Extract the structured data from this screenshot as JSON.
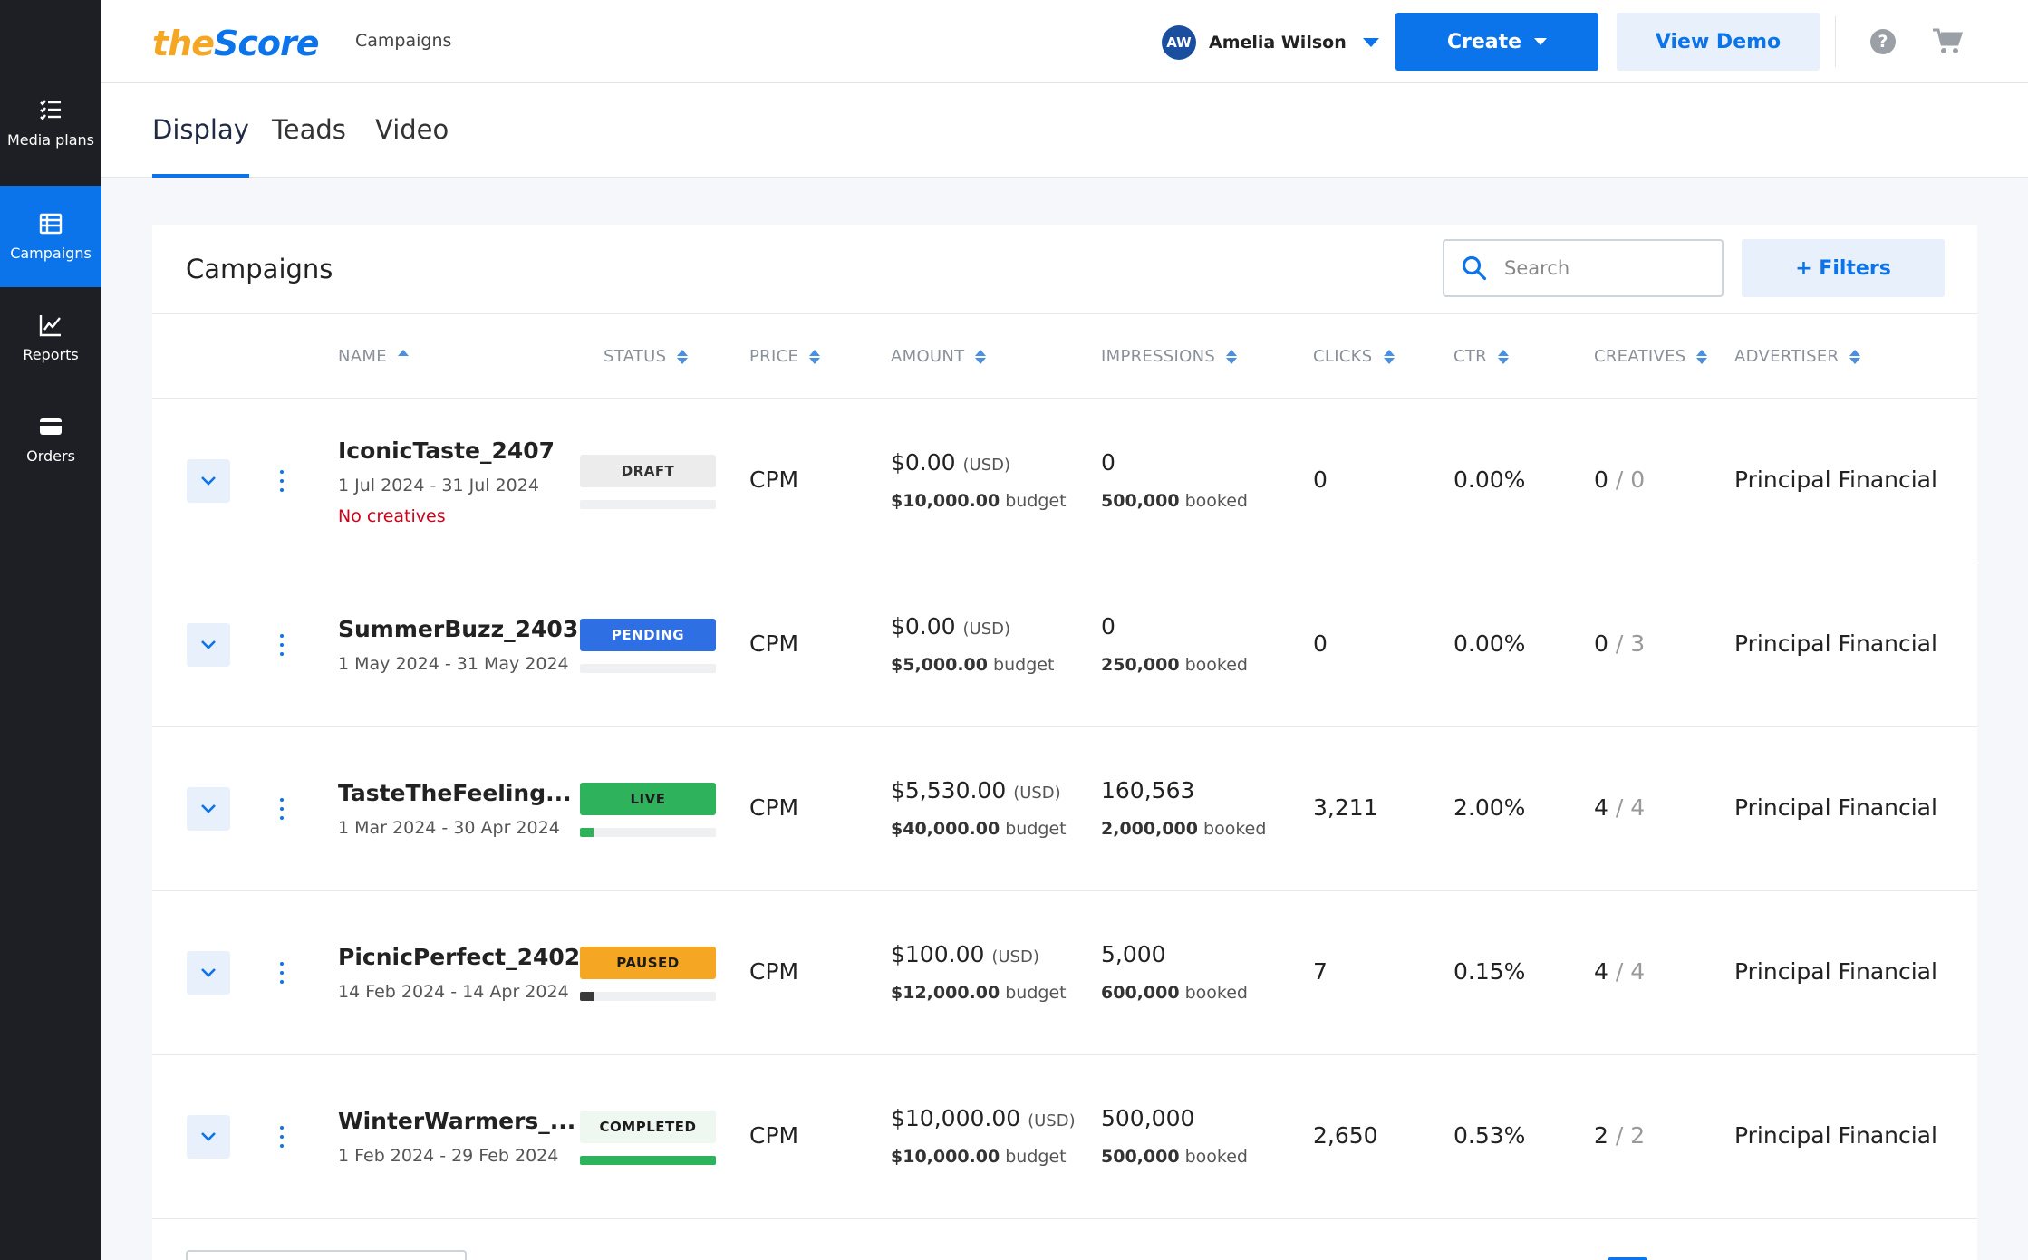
{
  "sidebar": {
    "items": [
      {
        "label": "Media plans",
        "icon": "checklist-icon"
      },
      {
        "label": "Campaigns",
        "icon": "table-icon"
      },
      {
        "label": "Reports",
        "icon": "line-chart-icon"
      },
      {
        "label": "Orders",
        "icon": "credit-card-icon"
      }
    ],
    "active": "Campaigns"
  },
  "header": {
    "logo_the": "the",
    "logo_score": "Score",
    "breadcrumb": "Campaigns",
    "user_initials": "AW",
    "user_name": "Amelia Wilson",
    "create_label": "Create",
    "demo_label": "View Demo",
    "help_glyph": "?"
  },
  "tabs": [
    {
      "label": "Display",
      "active": true
    },
    {
      "label": "Teads",
      "active": false
    },
    {
      "label": "Video",
      "active": false
    }
  ],
  "campaigns_card": {
    "title": "Campaigns",
    "search_placeholder": "Search",
    "filters_label": "+ Filters"
  },
  "table": {
    "columns": [
      "NAME",
      "STATUS",
      "PRICE",
      "AMOUNT",
      "IMPRESSIONS",
      "CLICKS",
      "CTR",
      "CREATIVES",
      "ADVERTISER"
    ],
    "sorted_by": "NAME",
    "rows": [
      {
        "name": "IconicTaste_2407",
        "dates": "1 Jul 2024 - 31 Jul 2024",
        "warning": "No creatives",
        "status": "DRAFT",
        "progress": 0,
        "price": "CPM",
        "amount": "$0.00",
        "currency": "(USD)",
        "budget": "$10,000.00",
        "budget_label": "budget",
        "impressions": "0",
        "booked": "500,000",
        "booked_label": "booked",
        "clicks": "0",
        "ctr": "0.00%",
        "creatives_used": "0",
        "creatives_total": "/ 0",
        "advertiser": "Principal Financial"
      },
      {
        "name": "SummerBuzz_2403",
        "dates": "1 May 2024 - 31 May 2024",
        "warning": "",
        "status": "PENDING",
        "progress": 0,
        "price": "CPM",
        "amount": "$0.00",
        "currency": "(USD)",
        "budget": "$5,000.00",
        "budget_label": "budget",
        "impressions": "0",
        "booked": "250,000",
        "booked_label": "booked",
        "clicks": "0",
        "ctr": "0.00%",
        "creatives_used": "0",
        "creatives_total": "/ 3",
        "advertiser": "Principal Financial"
      },
      {
        "name": "TasteTheFeeling...",
        "dates": "1 Mar 2024 - 30 Apr 2024",
        "warning": "",
        "status": "LIVE",
        "progress": 0.08,
        "price": "CPM",
        "amount": "$5,530.00",
        "currency": "(USD)",
        "budget": "$40,000.00",
        "budget_label": "budget",
        "impressions": "160,563",
        "booked": "2,000,000",
        "booked_label": "booked",
        "clicks": "3,211",
        "ctr": "2.00%",
        "creatives_used": "4",
        "creatives_total": "/ 4",
        "advertiser": "Principal Financial"
      },
      {
        "name": "PicnicPerfect_2402",
        "dates": "14 Feb 2024 - 14 Apr 2024",
        "warning": "",
        "status": "PAUSED",
        "progress": 0.1,
        "price": "CPM",
        "amount": "$100.00",
        "currency": "(USD)",
        "budget": "$12,000.00",
        "budget_label": "budget",
        "impressions": "5,000",
        "booked": "600,000",
        "booked_label": "booked",
        "clicks": "7",
        "ctr": "0.15%",
        "creatives_used": "4",
        "creatives_total": "/ 4",
        "advertiser": "Principal Financial"
      },
      {
        "name": "WinterWarmers_...",
        "dates": "1 Feb 2024 - 29 Feb 2024",
        "warning": "",
        "status": "COMPLETED",
        "progress": 1.0,
        "price": "CPM",
        "amount": "$10,000.00",
        "currency": "(USD)",
        "budget": "$10,000.00",
        "budget_label": "budget",
        "impressions": "500,000",
        "booked": "500,000",
        "booked_label": "booked",
        "clicks": "2,650",
        "ctr": "0.53%",
        "creatives_used": "2",
        "creatives_total": "/ 2",
        "advertiser": "Principal Financial"
      }
    ]
  },
  "colors": {
    "accent": "#0c74ea",
    "sidebar_bg": "#1e1f24",
    "status": {
      "DRAFT": {
        "bg": "#ececec",
        "fg": "#333333",
        "bar": "#eef0f2"
      },
      "PENDING": {
        "bg": "#2f6fe4",
        "fg": "#ffffff",
        "bar": "#eef0f2"
      },
      "LIVE": {
        "bg": "#2eb25b",
        "fg": "#1c1c1c",
        "bar": "#2eb25b"
      },
      "PAUSED": {
        "bg": "#f5a623",
        "fg": "#1c1c1c",
        "bar": "#3a3a3a"
      },
      "COMPLETED": {
        "bg": "#eef7f0",
        "fg": "#1c1c1c",
        "bar": "#2eb25b"
      }
    }
  }
}
